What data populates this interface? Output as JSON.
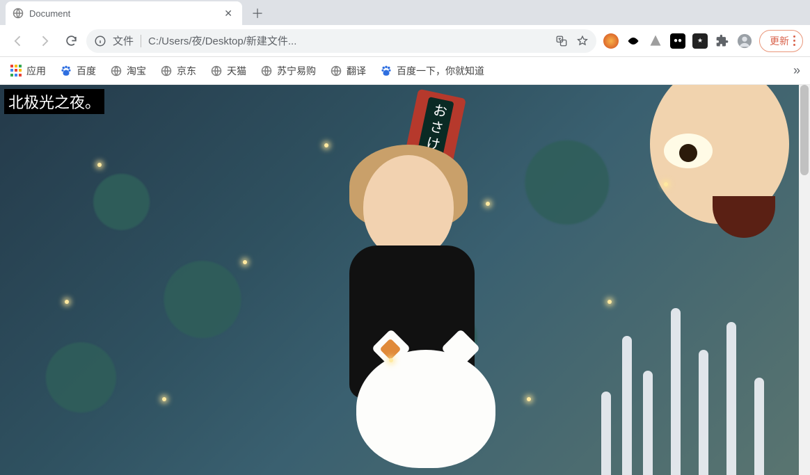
{
  "tab": {
    "title": "Document"
  },
  "omnibox": {
    "file_label": "文件",
    "url": "C:/Users/夜/Desktop/新建文件..."
  },
  "update_button": "更新",
  "bookmarks": {
    "apps": "应用",
    "items": [
      {
        "label": "百度"
      },
      {
        "label": "淘宝"
      },
      {
        "label": "京东"
      },
      {
        "label": "天猫"
      },
      {
        "label": "苏宁易购"
      },
      {
        "label": "翻译"
      },
      {
        "label": "百度一下，你就知道"
      }
    ]
  },
  "page": {
    "watermark": "北极光之夜。",
    "red_box_label": "おさけ"
  }
}
